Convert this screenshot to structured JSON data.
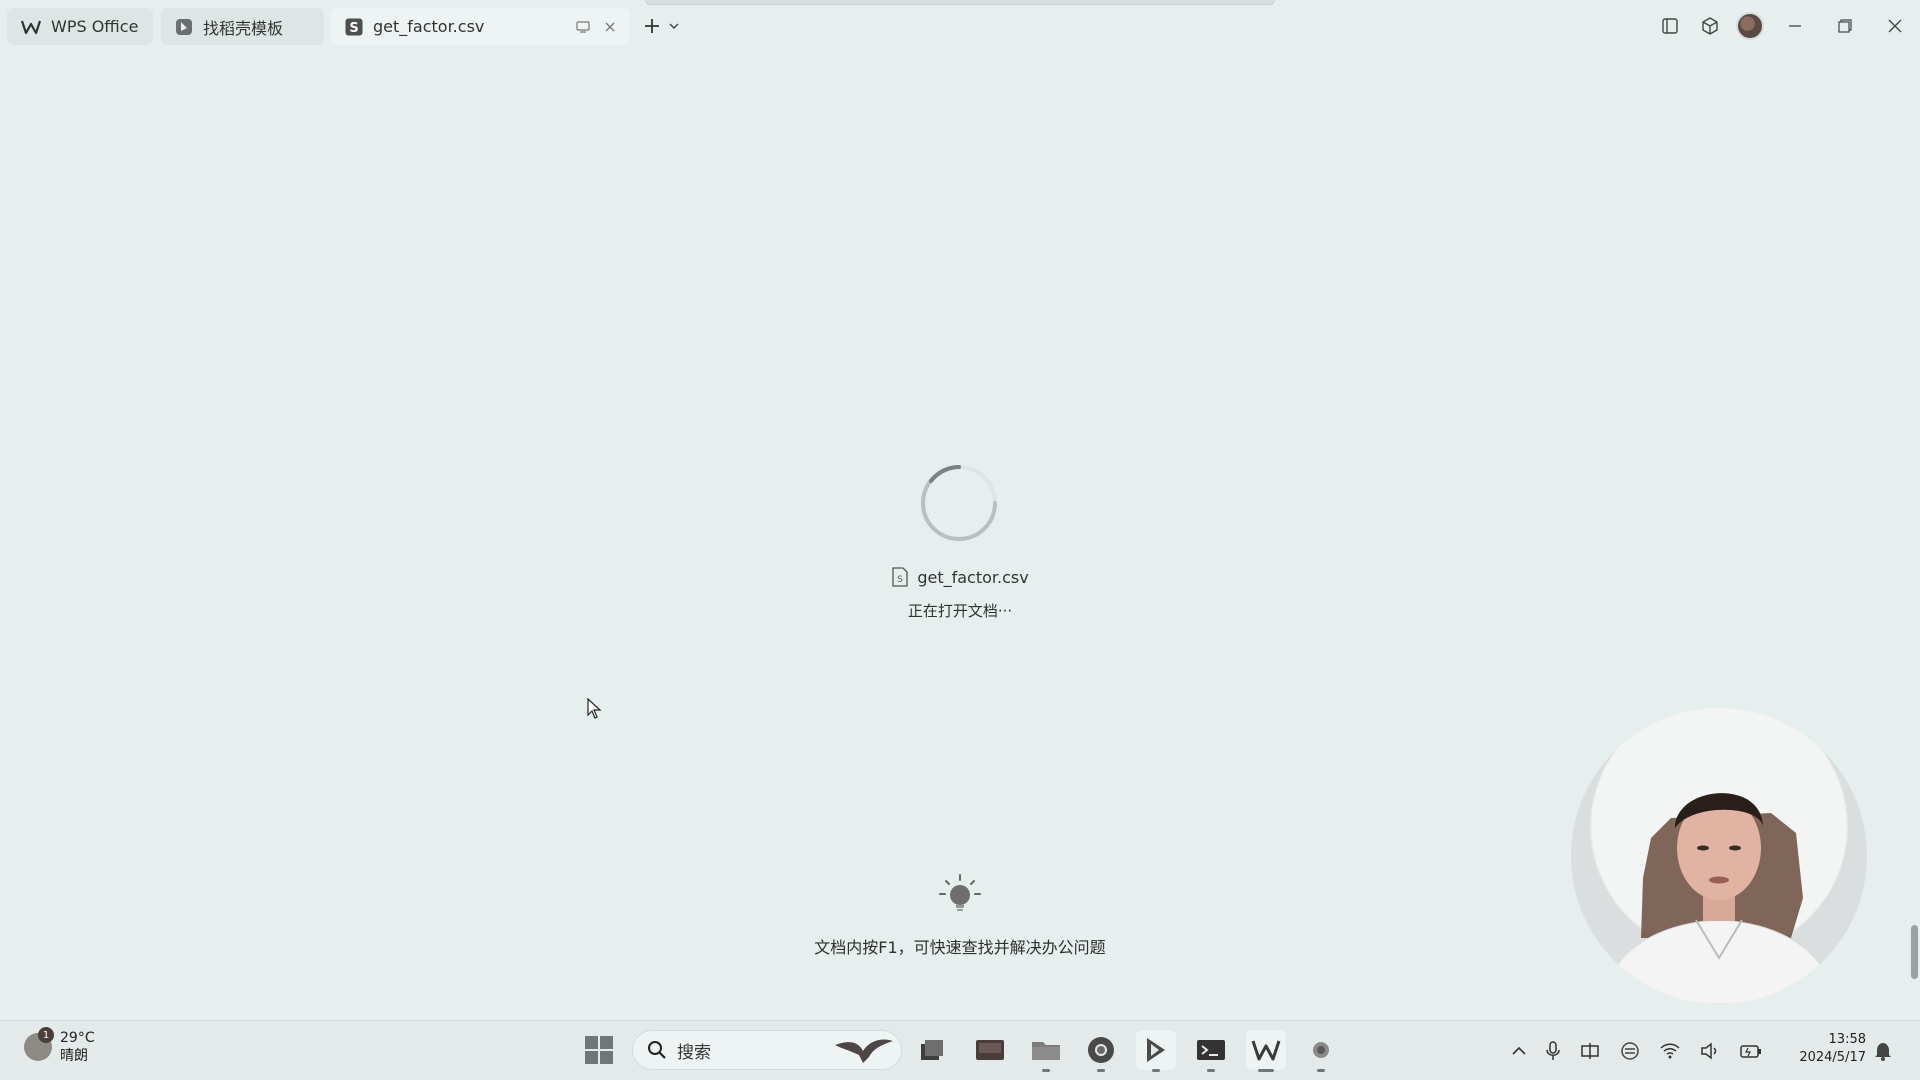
{
  "tabs": [
    {
      "label": "WPS Office",
      "icon": "wps-logo-icon"
    },
    {
      "label": "找稻壳模板",
      "icon": "docer-template-icon"
    },
    {
      "label": "get_factor.csv",
      "icon": "spreadsheet-s-icon",
      "active": true
    }
  ],
  "loading": {
    "file_name": "get_factor.csv",
    "status": "正在打开文档···"
  },
  "tip": {
    "text": "文档内按F1，可快速查找并解决办公问题"
  },
  "taskbar": {
    "weather": {
      "badge": "1",
      "temperature": "29°C",
      "condition": "晴朗"
    },
    "search_placeholder": "搜索",
    "clock": {
      "time": "13:58",
      "date": "2024/5/17"
    }
  },
  "colors": {
    "background": "#e7eeee",
    "tab_active": "#eef3f3",
    "taskbar": "#e4eaea"
  }
}
